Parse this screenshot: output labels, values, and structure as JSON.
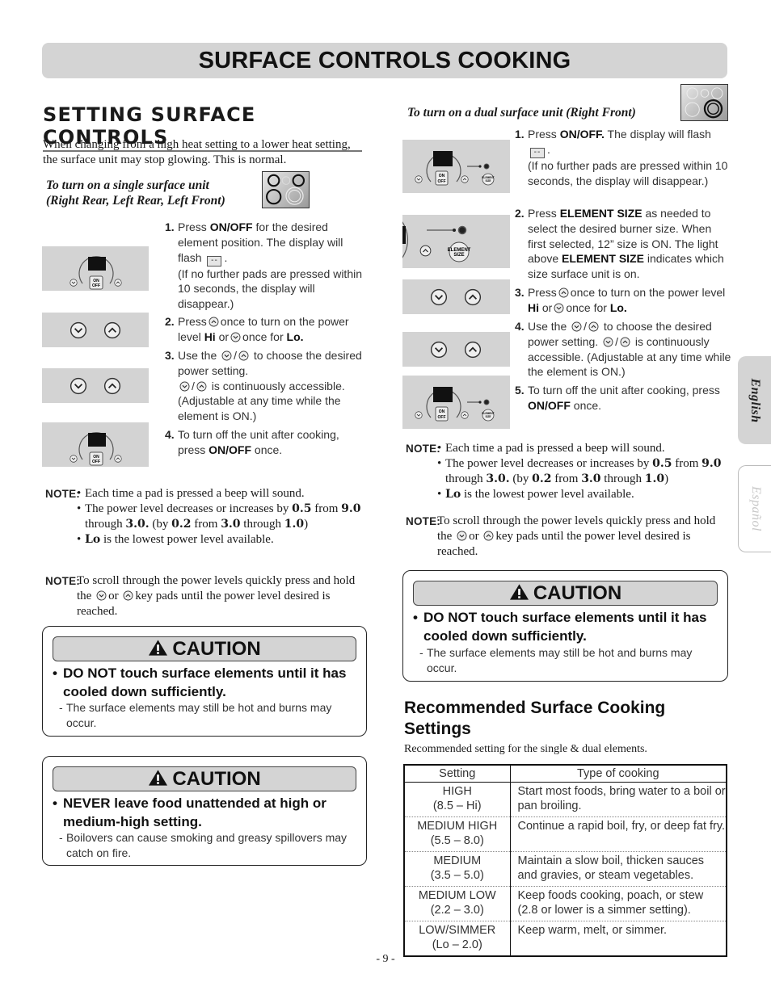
{
  "page_title": "SURFACE CONTROLS COOKING",
  "section_heading": "SETTING SURFACE CONTROLS",
  "intro": "When changing from a high heat setting to a lower heat setting, the surface unit may stop glowing. This is normal.",
  "single": {
    "subhead_line1": "To turn on a single surface unit",
    "subhead_line2": "(Right Rear, Left Rear, Left Front)",
    "steps": [
      {
        "num": "1.",
        "pre": "Press ",
        "bold": "ON/OFF",
        "post": " for the desired element position. The display will flash",
        "after_box": ".",
        "extra": "(If no further pads are pressed within 10 seconds, the display will disappear.)"
      },
      {
        "num": "2.",
        "t1": "Press",
        "t2": "once to turn on the power level",
        "b1": "Hi",
        "t3": "or",
        "t4": "once for",
        "b2": "Lo."
      },
      {
        "num": "3.",
        "t1": "Use the",
        "t2": "/",
        "t3": "to choose the desired power setting.",
        "t4": "/",
        "t5": "is continuously accessible. (Adjustable at any time while the element is ON.)"
      },
      {
        "num": "4.",
        "t1": "To turn off the unit after cooking, press ",
        "bold": "ON/OFF",
        "t2": " once."
      }
    ]
  },
  "dual": {
    "subhead": "To turn on a dual surface unit (Right Front)",
    "steps": [
      {
        "num": "1.",
        "pre": "Press ",
        "bold": "ON/OFF.",
        "post": " The display will flash",
        "after_box": ".",
        "extra": "(If no further pads are pressed within 10 seconds, the display will disappear.)"
      },
      {
        "num": "2.",
        "t1": "Press ",
        "b1": "ELEMENT SIZE",
        "t2": " as needed to select the desired burner size. When first selected, 12” size is ON. The light above ",
        "b2": "ELEMENT SIZE",
        "t3": " indicates which size surface unit is on."
      },
      {
        "num": "3.",
        "t1": "Press",
        "t2": "once to turn on the power level",
        "b1": "Hi",
        "t3": "or",
        "t4": "once for",
        "b2": "Lo."
      },
      {
        "num": "4.",
        "t1": "Use the",
        "t2": "/",
        "t3": "to choose the desired power setting.",
        "t4": "/",
        "t5": "is continuously accessible. (Adjustable at any time while the element is ON.)"
      },
      {
        "num": "5.",
        "t1": "To turn off the unit after cooking, press ",
        "bold": "ON/OFF",
        "t2": " once."
      }
    ]
  },
  "display_flash": "--",
  "panel_labels": {
    "on": "ON",
    "off": "OFF",
    "element": "ELEMENT",
    "size": "SIZE"
  },
  "note_label": "NOTE:",
  "notes": {
    "bullets": {
      "b1": "Each time a pad is pressed a beep will sound.",
      "b2_pre": "The power level decreases or increases by ",
      "v1": "0.5",
      "b2_from": " from ",
      "v2": "9.0",
      "b2_through": " through ",
      "v3": "3.0.",
      "b2_by": " (by ",
      "v4": "0.2",
      "b2_from2": " from ",
      "v5": "3.0",
      "b2_through2": " through ",
      "v6": "1.0",
      "b2_end": ")",
      "b3_bold": "Lo",
      "b3": " is the lowest power level available."
    },
    "scroll": {
      "t1": "To scroll through the power levels quickly press and hold the",
      "t2": "or",
      "t3": "key pads until the power level desired is reached."
    }
  },
  "cautions": [
    {
      "label": "CAUTION",
      "main": "DO NOT touch surface elements until it has cooled down sufficiently.",
      "sub": "The surface elements may still be hot and burns may occur."
    },
    {
      "label": "CAUTION",
      "main": "NEVER leave food unattended at high or medium-high setting.",
      "sub": "Boilovers can cause smoking and greasy spillovers may catch on fire."
    },
    {
      "label": "CAUTION",
      "main": "DO NOT touch surface elements until it has cooled down sufficiently.",
      "sub": "The surface elements may still be hot and burns may occur."
    }
  ],
  "recommended": {
    "heading": "Recommended Surface Cooking Settings",
    "subtitle": "Recommended setting for the single & dual elements.",
    "columns": [
      "Setting",
      "Type of cooking"
    ],
    "rows": [
      {
        "setting": "HIGH",
        "range": "(8.5 – Hi)",
        "type": "Start most foods, bring water to a boil or pan broiling."
      },
      {
        "setting": "MEDIUM HIGH",
        "range": "(5.5 – 8.0)",
        "type": "Continue a rapid boil, fry, or deep fat fry."
      },
      {
        "setting": "MEDIUM",
        "range": "(3.5 – 5.0)",
        "type": "Maintain a slow boil, thicken sauces and gravies, or steam vegetables."
      },
      {
        "setting": "MEDIUM LOW",
        "range": "(2.2 – 3.0)",
        "type": "Keep foods cooking, poach, or stew (2.8 or lower is a simmer setting)."
      },
      {
        "setting": "LOW/SIMMER",
        "range": "(Lo – 2.0)",
        "type": "Keep warm, melt, or simmer."
      }
    ]
  },
  "page_number": "- 9 -",
  "side_tabs": {
    "english": "English",
    "espanol": "Español"
  }
}
